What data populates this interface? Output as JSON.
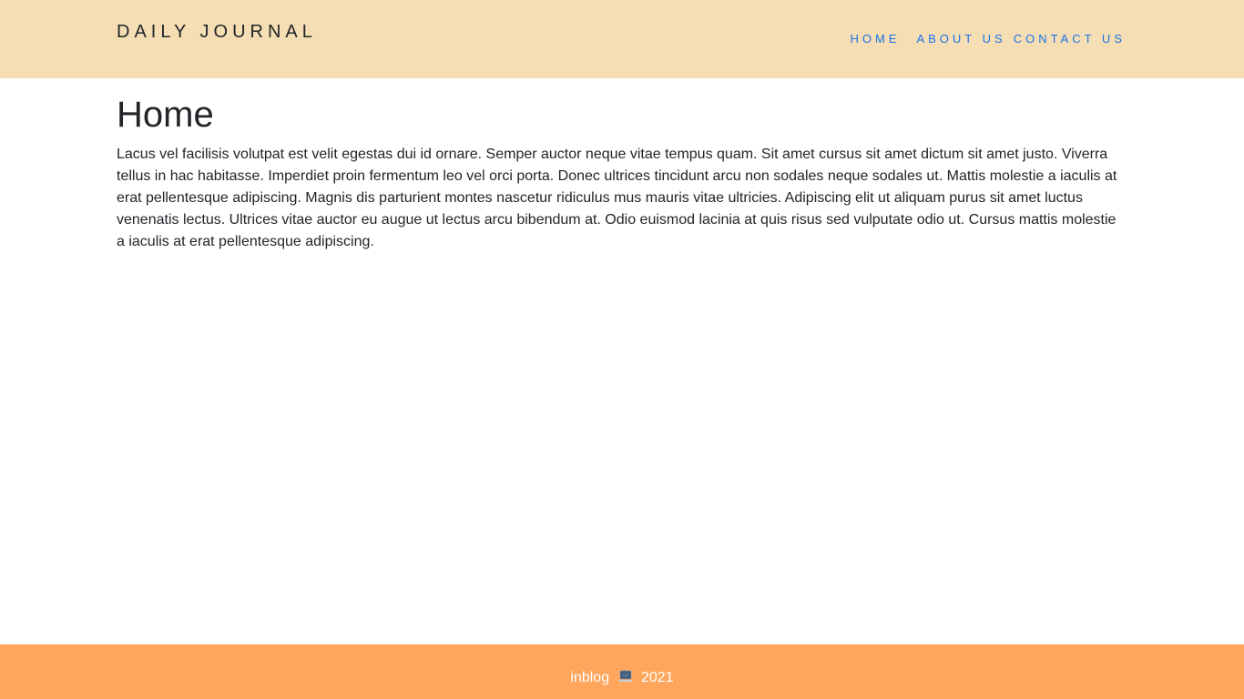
{
  "header": {
    "brand": "DAILY JOURNAL",
    "nav": [
      {
        "label": "HOME"
      },
      {
        "label": "ABOUT US"
      },
      {
        "label": "CONTACT US"
      }
    ]
  },
  "main": {
    "title": "Home",
    "content": "Lacus vel facilisis volutpat est velit egestas dui id ornare. Semper auctor neque vitae tempus quam. Sit amet cursus sit amet dictum sit amet justo. Viverra tellus in hac habitasse. Imperdiet proin fermentum leo vel orci porta. Donec ultrices tincidunt arcu non sodales neque sodales ut. Mattis molestie a iaculis at erat pellentesque adipiscing. Magnis dis parturient montes nascetur ridiculus mus mauris vitae ultricies. Adipiscing elit ut aliquam purus sit amet luctus venenatis lectus. Ultrices vitae auctor eu augue ut lectus arcu bibendum at. Odio euismod lacinia at quis risus sed vulputate odio ut. Cursus mattis molestie a iaculis at erat pellentesque adipiscing."
  },
  "footer": {
    "brand": "inblog",
    "icon": "laptop-icon",
    "year": "2021"
  },
  "colors": {
    "header_bg": "#f5deb3",
    "footer_bg": "#ffa65c",
    "nav_link": "#1a73e8"
  }
}
